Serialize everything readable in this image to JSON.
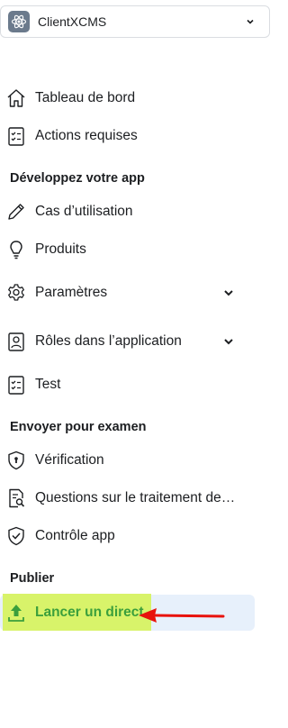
{
  "app": {
    "name": "ClientXCMS",
    "icon": "react-atom-icon"
  },
  "nav": {
    "dashboard": "Tableau de bord",
    "required_actions": "Actions requises",
    "section_develop": "Développez votre app",
    "use_cases": "Cas d’utilisation",
    "products": "Produits",
    "settings": "Paramètres",
    "roles": "Rôles dans l’application",
    "test": "Test",
    "section_review": "Envoyer pour examen",
    "verification": "Vérification",
    "data_questions": "Questions sur le traitement de…",
    "app_review": "Contrôle app",
    "section_publish": "Publier",
    "go_live": "Lancer un direct"
  },
  "colors": {
    "active_background": "#e7f0fb",
    "highlight": "#d8f36a",
    "active_text": "#3b9f3c",
    "annotation_arrow": "#e8120c"
  }
}
